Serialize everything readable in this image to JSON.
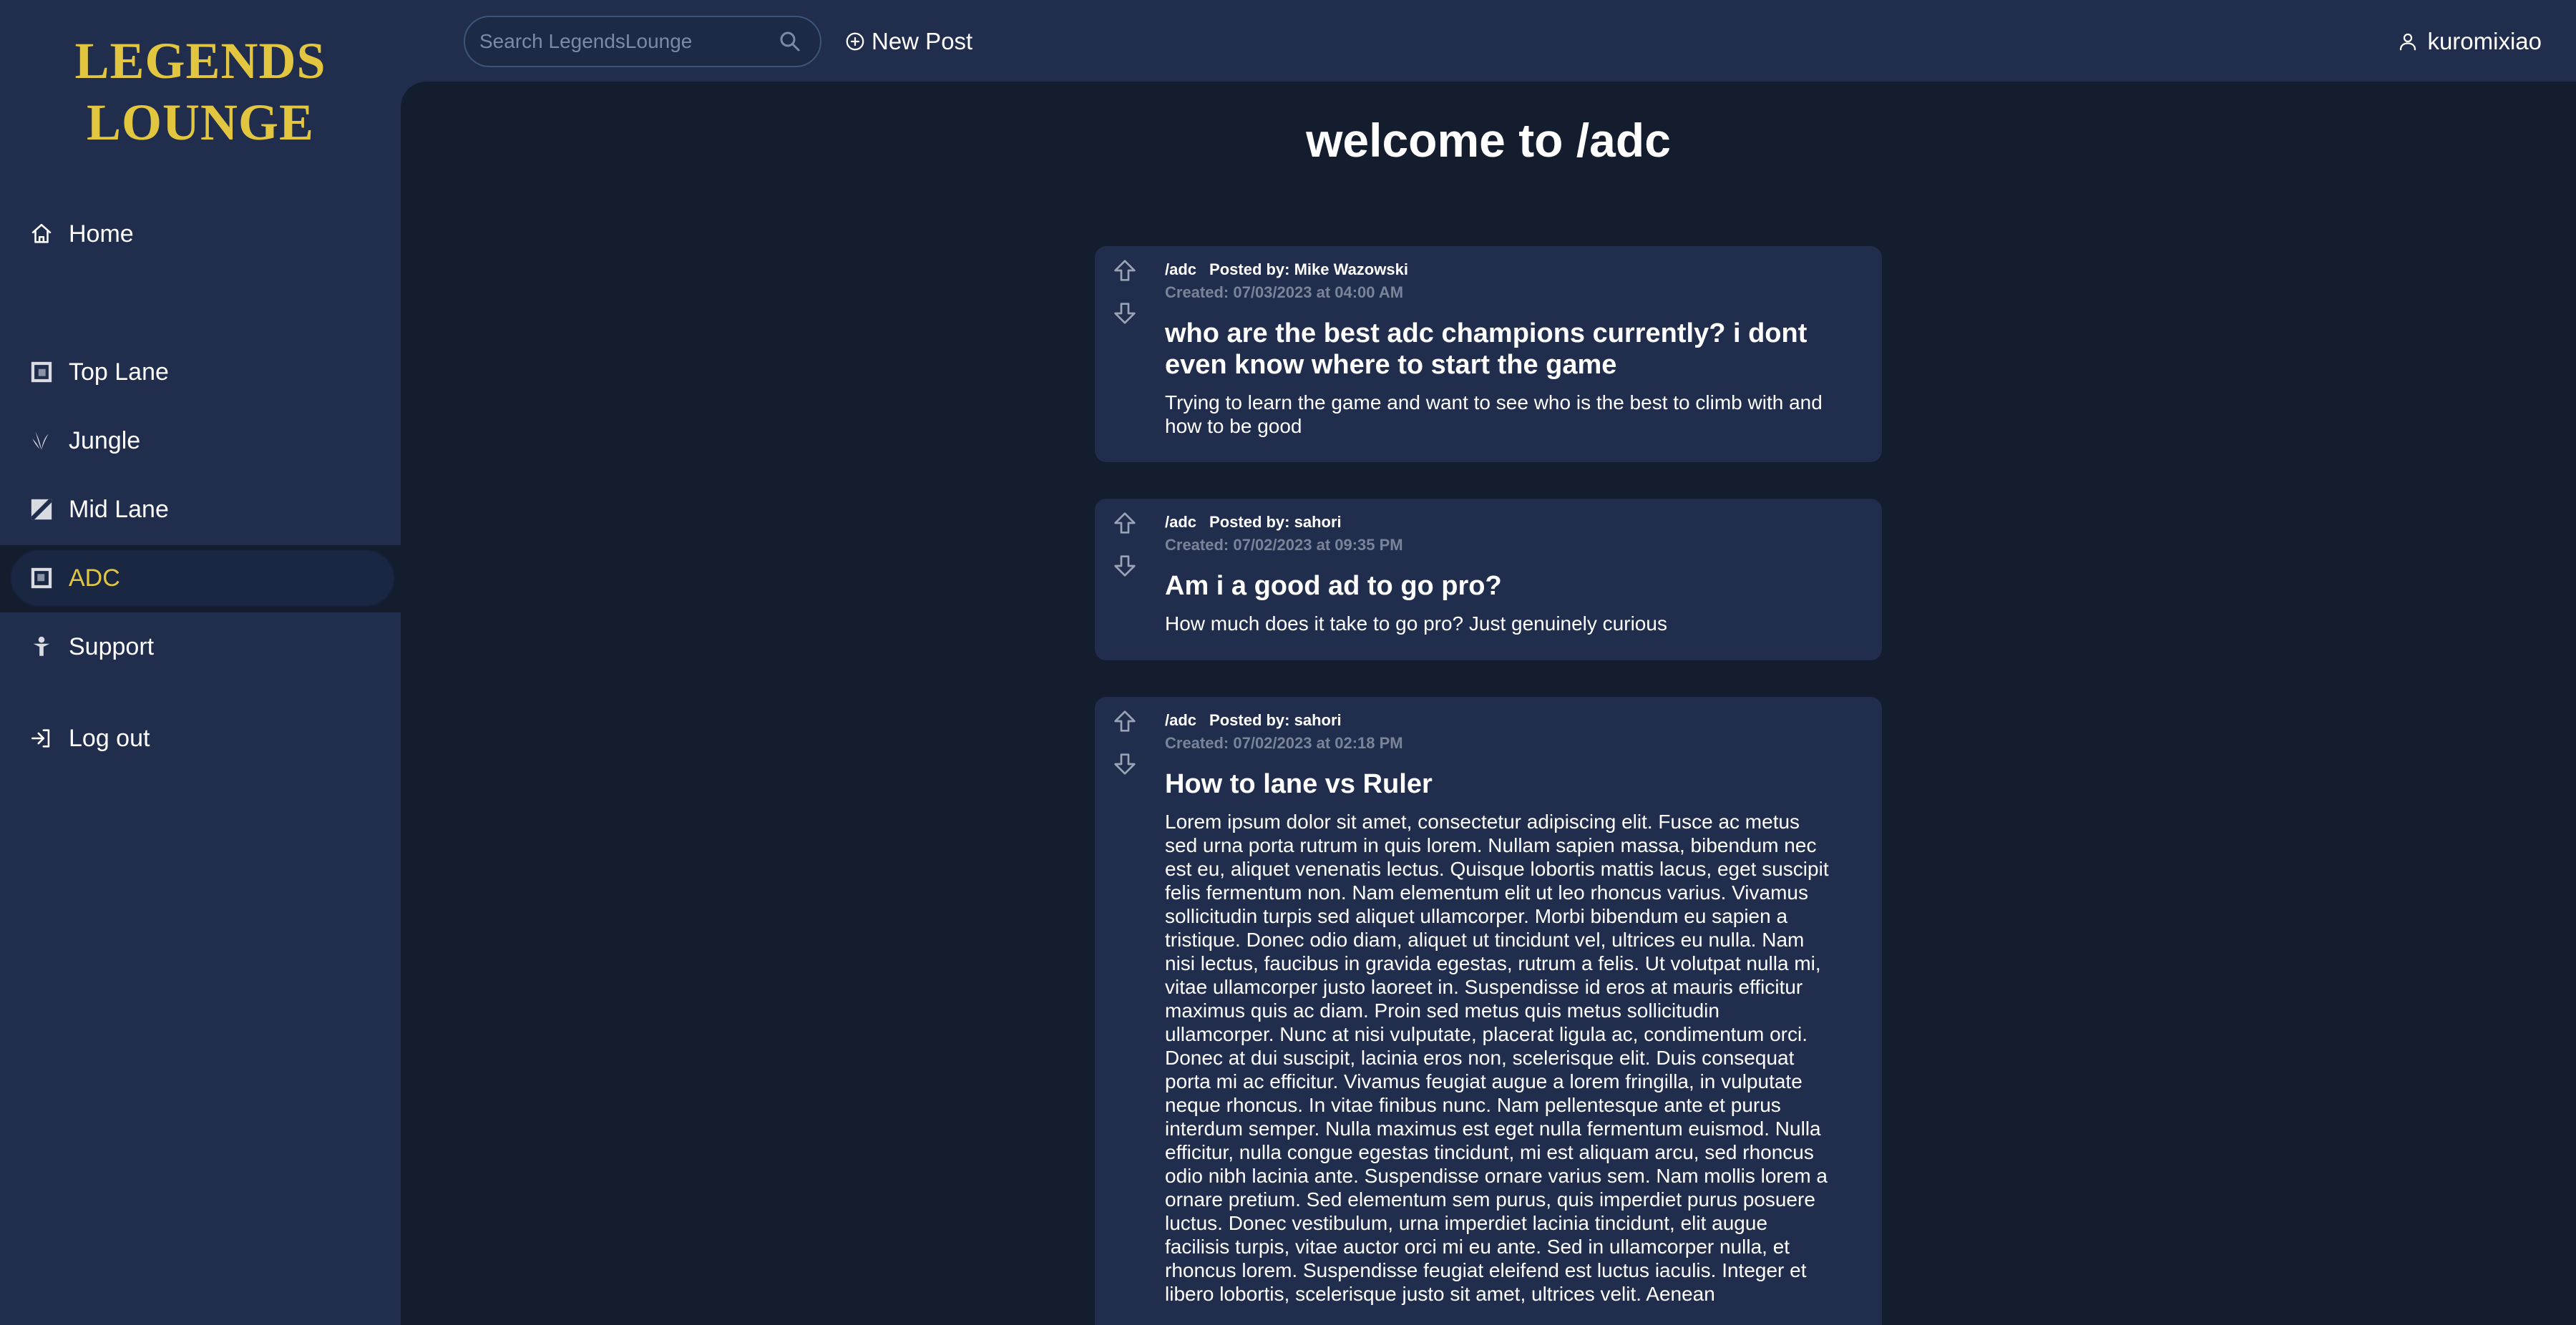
{
  "brand": {
    "line1": "LEGENDS",
    "line2": "LOUNGE"
  },
  "sidebar": {
    "items": [
      {
        "label": "Home",
        "icon": "home-icon"
      },
      {
        "label": "Top Lane",
        "icon": "top-lane-icon"
      },
      {
        "label": "Jungle",
        "icon": "jungle-icon"
      },
      {
        "label": "Mid Lane",
        "icon": "mid-lane-icon"
      },
      {
        "label": "ADC",
        "icon": "adc-icon",
        "active": true
      },
      {
        "label": "Support",
        "icon": "support-icon"
      },
      {
        "label": "Log out",
        "icon": "logout-icon"
      }
    ]
  },
  "topbar": {
    "search_placeholder": "Search LegendsLounge",
    "new_post_label": "New Post",
    "username": "kuromixiao"
  },
  "main": {
    "title": "welcome to /adc",
    "posts": [
      {
        "subreddit": "/adc",
        "posted_by": "Posted by: Mike Wazowski",
        "created": "Created: 07/03/2023 at 04:00 AM",
        "title": "who are the best adc champions currently? i dont even know where to start the game",
        "text": "Trying to learn the game and want to see who is the best to climb with and how to be good"
      },
      {
        "subreddit": "/adc",
        "posted_by": "Posted by: sahori",
        "created": "Created: 07/02/2023 at 09:35 PM",
        "title": "Am i a good ad to go pro?",
        "text": "How much does it take to go pro? Just genuinely curious"
      },
      {
        "subreddit": "/adc",
        "posted_by": "Posted by: sahori",
        "created": "Created: 07/02/2023 at 02:18 PM",
        "title": "How to lane vs Ruler",
        "text": "Lorem ipsum dolor sit amet, consectetur adipiscing elit. Fusce ac metus sed urna porta rutrum in quis lorem. Nullam sapien massa, bibendum nec est eu, aliquet venenatis lectus. Quisque lobortis mattis lacus, eget suscipit felis fermentum non. Nam elementum elit ut leo rhoncus varius. Vivamus sollicitudin turpis sed aliquet ullamcorper. Morbi bibendum eu sapien a tristique. Donec odio diam, aliquet ut tincidunt vel, ultrices eu nulla. Nam nisi lectus, faucibus in gravida egestas, rutrum a felis. Ut volutpat nulla mi, vitae ullamcorper justo laoreet in. Suspendisse id eros at mauris efficitur maximus quis ac diam. Proin sed metus quis metus sollicitudin ullamcorper. Nunc at nisi vulputate, placerat ligula ac, condimentum orci. Donec at dui suscipit, lacinia eros non, scelerisque elit. Duis consequat porta mi ac efficitur. Vivamus feugiat augue a lorem fringilla, in vulputate neque rhoncus. In vitae finibus nunc. Nam pellentesque ante et purus interdum semper. Nulla maximus est eget nulla fermentum euismod. Nulla efficitur, nulla congue egestas tincidunt, mi est aliquam arcu, sed rhoncus odio nibh lacinia ante. Suspendisse ornare varius sem. Nam mollis lorem a ornare pretium. Sed elementum sem purus, quis imperdiet purus posuere luctus. Donec vestibulum, urna imperdiet lacinia tincidunt, elit augue facilisis turpis, vitae auctor orci mi eu ante. Sed in ullamcorper nulla, et rhoncus lorem. Suspendisse feugiat eleifend est luctus iaculis. Integer et libero lobortis, scelerisque justo sit amet, ultrices velit. Aenean"
      }
    ]
  },
  "colors": {
    "background": "#131d2d",
    "panel": "#212d4c",
    "accent": "#e2c63f",
    "muted": "#7a8499"
  }
}
